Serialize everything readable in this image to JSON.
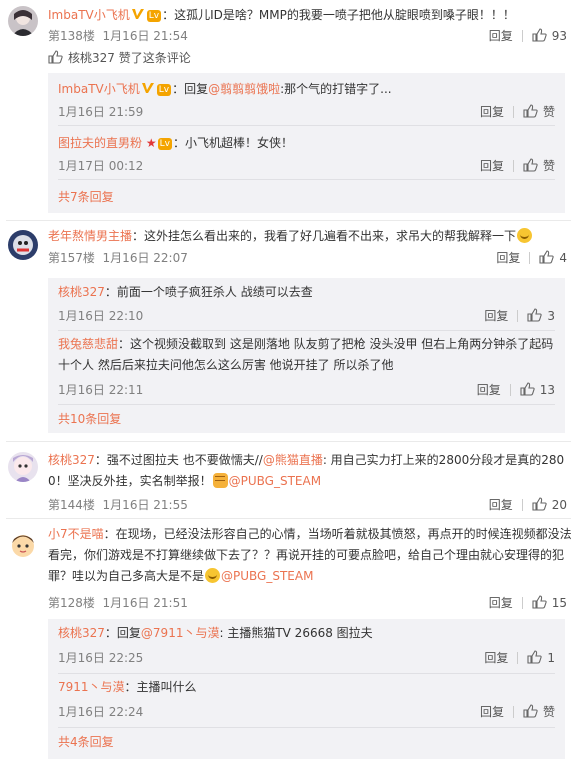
{
  "colors": {
    "link": "#eb7350",
    "meta": "#808080",
    "subbox": "#f2f2f5"
  },
  "comments": [
    {
      "user": "ImbaTV小飞机",
      "text": "：这孤儿ID是啥？MMP的我要一喷子把他从腚眼喷到嗓子眼！！！",
      "floor": "第138楼",
      "time": "1月16日 21:54",
      "reply_label": "回复",
      "likes": "93",
      "liked_by": "核桃327 赞了这条评论",
      "replies": [
        {
          "user": "ImbaTV小飞机",
          "text_pre": "：回复",
          "mention": "@翦翦翦饿啦",
          "text_post": ":那个气的打错字了...",
          "time": "1月16日 21:59",
          "reply_label": "回复",
          "likes": "赞"
        },
        {
          "user": "图拉夫的直男粉",
          "text": "：小飞机超棒！女侠！",
          "time": "1月17日 00:12",
          "reply_label": "回复",
          "likes": "赞"
        }
      ],
      "more": "共7条回复"
    },
    {
      "user": "老年熬情男主播",
      "text": "：这外挂怎么看出来的，我看了好几遍看不出来，求吊大的帮我解释一下",
      "floor": "第157楼",
      "time": "1月16日 22:07",
      "reply_label": "回复",
      "likes": "4",
      "replies": [
        {
          "user": "核桃327",
          "text": "：前面一个喷子疯狂杀人 战绩可以去查",
          "time": "1月16日 22:10",
          "reply_label": "回复",
          "likes": "3"
        },
        {
          "user": "我兔慈悲甜",
          "text": "：这个视频没截取到 这是刚落地 队友剪了把枪 没头没甲 但右上角两分钟杀了起码十个人 然后后来拉夫问他怎么这么厉害 他说开挂了 所以杀了他",
          "time": "1月16日 22:11",
          "reply_label": "回复",
          "likes": "13"
        }
      ],
      "more": "共10条回复"
    },
    {
      "user": "核桃327",
      "text_pre": "：强不过图拉夫 也不要做懦夫//",
      "mention1": "@熊猫直播",
      "text_mid": ": 用自己实力打上来的2800分段才是真的2800！坚决反外挂，实名制举报！",
      "mention2": "@PUBG_STEAM",
      "floor": "第144楼",
      "time": "1月16日 21:55",
      "reply_label": "回复",
      "likes": "20"
    },
    {
      "user": "小7不是喵",
      "text": "：在现场，已经没法形容自己的心情，当场听着就极其愤怒，再点开的时候连视频都没法看完，你们游戏是不打算继续做下去了？？再说开挂的可要点脸吧，给自己个理由就心安理得的犯罪？哇以为自己多高大是不是",
      "mention": "@PUBG_STEAM",
      "floor": "第128楼",
      "time": "1月16日 21:51",
      "reply_label": "回复",
      "likes": "15",
      "replies": [
        {
          "user": "核桃327",
          "text_pre": "：回复",
          "mention": "@7911丶与漠",
          "text_post": ": 主播熊猫TV 26668 图拉夫",
          "time": "1月16日 22:25",
          "reply_label": "回复",
          "likes": "1"
        },
        {
          "user": "7911丶与漠",
          "text": "：主播叫什么",
          "time": "1月16日 22:24",
          "reply_label": "回复",
          "likes": "赞"
        }
      ],
      "more": "共4条回复"
    }
  ],
  "icons": {
    "like": "thumb-up-icon",
    "verified": "v-badge-icon",
    "level": "level-badge-icon"
  }
}
